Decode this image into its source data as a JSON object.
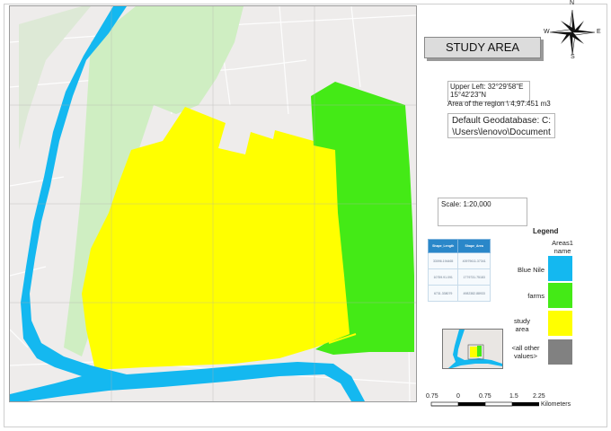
{
  "title": "STUDY AREA",
  "coords_text": "Upper Left: 32°29'58\"E 15°42'23\"N",
  "area_text": "Area of the region \\  4,97.451 m3",
  "geodatabase_text": "Default Geodatabase: C: \\Users\\lenovo\\Document",
  "scale_text": "Scale: 1:20,000",
  "table": {
    "headers": [
      "Shape_Length",
      "Shape_Area"
    ],
    "rows": [
      [
        "33096.194465",
        "40979611.37341"
      ],
      [
        "10759.91.091",
        "1779731.75183"
      ],
      [
        "6731.338079",
        "4982382.88933"
      ]
    ]
  },
  "legend": {
    "title": "Legend",
    "field_header": "Areas1 name",
    "items": [
      {
        "label": "Blue Nile",
        "color": "#14b8f0"
      },
      {
        "label": "farms",
        "color": "#44ea16"
      },
      {
        "label": "study area",
        "color": "#ffff00"
      },
      {
        "label": "<all other values>",
        "color": "#818181"
      }
    ]
  },
  "scalebar": {
    "ticks": [
      "0.75",
      "0",
      "0.75",
      "1.5",
      "2.25"
    ],
    "unit": "Kilometers"
  },
  "compass": {
    "n": "N",
    "s": "S",
    "e": "E",
    "w": "W"
  },
  "colors": {
    "river": "#14b8f0",
    "farms": "#44ea16",
    "study_area": "#ffff00",
    "urban_green": "#cfeec2",
    "basemap": "#eeeceb"
  }
}
